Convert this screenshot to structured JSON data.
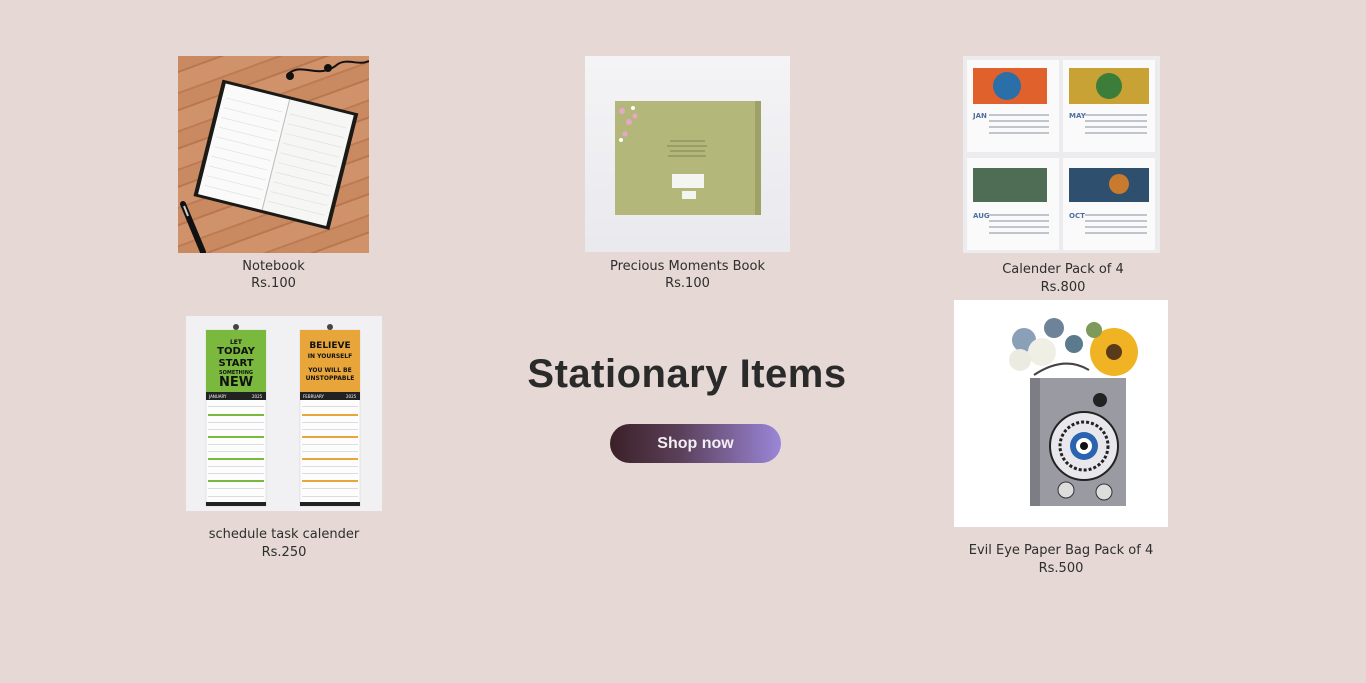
{
  "hero": {
    "title": "Stationary Items",
    "button_label": "Shop now"
  },
  "products": [
    {
      "name": "Notebook",
      "price": "Rs.100"
    },
    {
      "name": "Precious Moments Book",
      "price": "Rs.100"
    },
    {
      "name": "Calender Pack of 4",
      "price": "Rs.800"
    },
    {
      "name": "schedule task calender",
      "price": "Rs.250"
    },
    {
      "name": "Evil Eye Paper Bag Pack of 4",
      "price": "Rs.500"
    }
  ],
  "images": {
    "schedule_left": [
      "LET",
      "TODAY",
      "START",
      "SOMETHING",
      "NEW",
      "JANUARY",
      "2025"
    ],
    "schedule_right": [
      "BELIEVE",
      "IN YOURSELF",
      "YOU WILL BE",
      "UNSTOPPABLE",
      "FEBRUARY",
      "2025"
    ],
    "calendar_months": [
      "JAN",
      "MAY",
      "AUG",
      "OCT"
    ]
  },
  "colors": {
    "background": "#e5d8d5",
    "button_start": "#3b2028",
    "button_end": "#9b86d9"
  }
}
